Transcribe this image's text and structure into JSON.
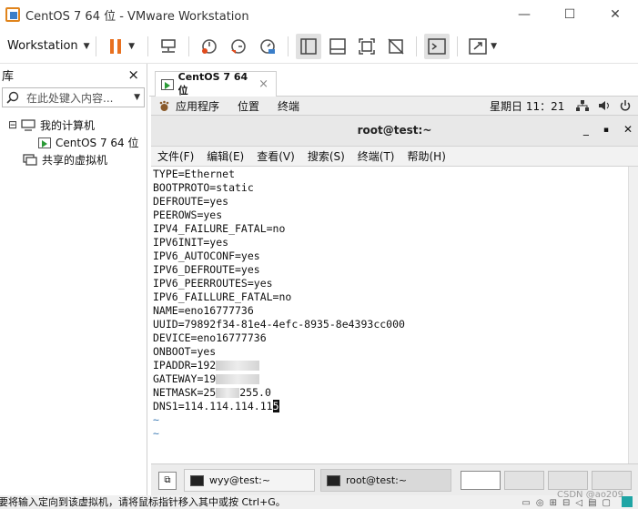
{
  "window": {
    "title": "CentOS 7 64 位 - VMware Workstation",
    "minimize": "—",
    "maximize": "☐",
    "close": "✕"
  },
  "toolbar": {
    "workstation_menu": "Workstation"
  },
  "library": {
    "title": "库",
    "close": "×",
    "search_placeholder": "在此处键入内容...",
    "tree": {
      "root_toggle": "⊟",
      "my_computer": "我的计算机",
      "vm_name": "CentOS 7 64 位",
      "shared_vms": "共享的虚拟机"
    }
  },
  "vm_tab": {
    "label": "CentOS 7 64 位",
    "close": "×"
  },
  "gnome_bar": {
    "applications": "应用程序",
    "places": "位置",
    "terminal": "终端",
    "clock": "星期日 11：21"
  },
  "terminal": {
    "title": "root@test:~",
    "minimize": "_",
    "maximize": "▪",
    "close": "✕",
    "menu": [
      "文件(F)",
      "编辑(E)",
      "查看(V)",
      "搜索(S)",
      "终端(T)",
      "帮助(H)"
    ],
    "lines": [
      "TYPE=Ethernet",
      "BOOTPROTO=static",
      "DEFROUTE=yes",
      "PEEROWS=yes",
      "IPV4_FAILURE_FATAL=no",
      "IPV6INIT=yes",
      "IPV6_AUTOCONF=yes",
      "IPV6_DEFROUTE=yes",
      "IPV6_PEERROUTES=yes",
      "IPV6_FAILLURE_FATAL=no",
      "NAME=eno16777736",
      "UUID=79892f34-81e4-4efc-8935-8e4393cc000",
      "DEVICE=eno16777736",
      "ONBOOT=yes"
    ],
    "ipaddr_prefix": "IPADDR=192",
    "gateway_prefix": "GATEWAY=19",
    "netmask_prefix": "NETMASK=25",
    "netmask_suffix": "255.0",
    "dns_text": "DNS1=114.114.114.11",
    "dns_cursor": "5",
    "tilde": "~"
  },
  "taskbar": {
    "task1": "wyy@test:~",
    "task2": "root@test:~"
  },
  "statusbar": {
    "message": "要将输入定向到该虚拟机，请将鼠标指针移入其中或按 Ctrl+G。",
    "watermark": "CSDN @ao209"
  }
}
